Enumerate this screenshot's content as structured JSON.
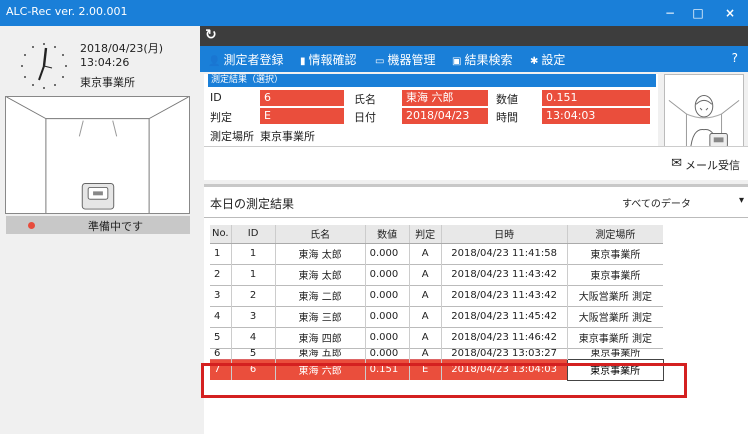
{
  "window": {
    "title": "ALC-Rec  ver. 2.00.001",
    "minimize_glyph": "−",
    "maximize_glyph": "□",
    "close_glyph": "×"
  },
  "left": {
    "date": "2018/04/23(月)",
    "time": "13:04:26",
    "office": "東京事業所",
    "status": "準備中です",
    "status_color": "#e74c3c"
  },
  "menu": {
    "items": [
      {
        "icon": "person-icon",
        "glyph": "👤",
        "label": "測定者登録"
      },
      {
        "icon": "info-icon",
        "glyph": "▮",
        "label": "情報確認"
      },
      {
        "icon": "device-icon",
        "glyph": "▭",
        "label": "機器管理"
      },
      {
        "icon": "calendar-icon",
        "glyph": "▣",
        "label": "結果検索"
      },
      {
        "icon": "gear-icon",
        "glyph": "✱",
        "label": "設定"
      }
    ],
    "help": "?"
  },
  "result": {
    "header": "測定結果（選択）",
    "labels": {
      "id": "ID",
      "judge": "判定",
      "name": "氏名",
      "date": "日付",
      "value": "数値",
      "time": "時間",
      "place": "測定場所"
    },
    "values": {
      "id": "6",
      "judge": "E",
      "name": "東海 六郎",
      "date": "2018/04/23",
      "value": "0.151",
      "time": "13:04:03",
      "place": "東京事業所"
    }
  },
  "mail": {
    "label": "メール受信"
  },
  "today": {
    "title": "本日の測定結果",
    "filter": "すべてのデータ",
    "columns": [
      "No.",
      "ID",
      "氏名",
      "数値",
      "判定",
      "日時",
      "測定場所"
    ],
    "rows": [
      [
        "1",
        "1",
        "東海 太郎",
        "0.000",
        "A",
        "2018/04/23 11:41:58",
        "東京事業所"
      ],
      [
        "2",
        "1",
        "東海 太郎",
        "0.000",
        "A",
        "2018/04/23 11:43:42",
        "東京事業所"
      ],
      [
        "3",
        "2",
        "東海 二郎",
        "0.000",
        "A",
        "2018/04/23 11:43:42",
        "大阪営業所 測定"
      ],
      [
        "4",
        "3",
        "東海 三郎",
        "0.000",
        "A",
        "2018/04/23 11:45:42",
        "大阪営業所 測定"
      ],
      [
        "5",
        "4",
        "東海 四郎",
        "0.000",
        "A",
        "2018/04/23 11:46:42",
        "東京事業所 測定"
      ],
      [
        "6",
        "5",
        "東海 五郎",
        "0.000",
        "A",
        "2018/04/23 13:03:27",
        "東京事業所"
      ],
      [
        "7",
        "6",
        "東海 六郎",
        "0.151",
        "E",
        "2018/04/23 13:04:03",
        "東京事業所"
      ]
    ],
    "highlight_row": 7,
    "highlight_color": "#ea4e3c"
  },
  "colors": {
    "accent": "#1a7fd8",
    "dark": "#3d3d3d",
    "alert": "#ea4e3c",
    "frame": "#d42020"
  }
}
